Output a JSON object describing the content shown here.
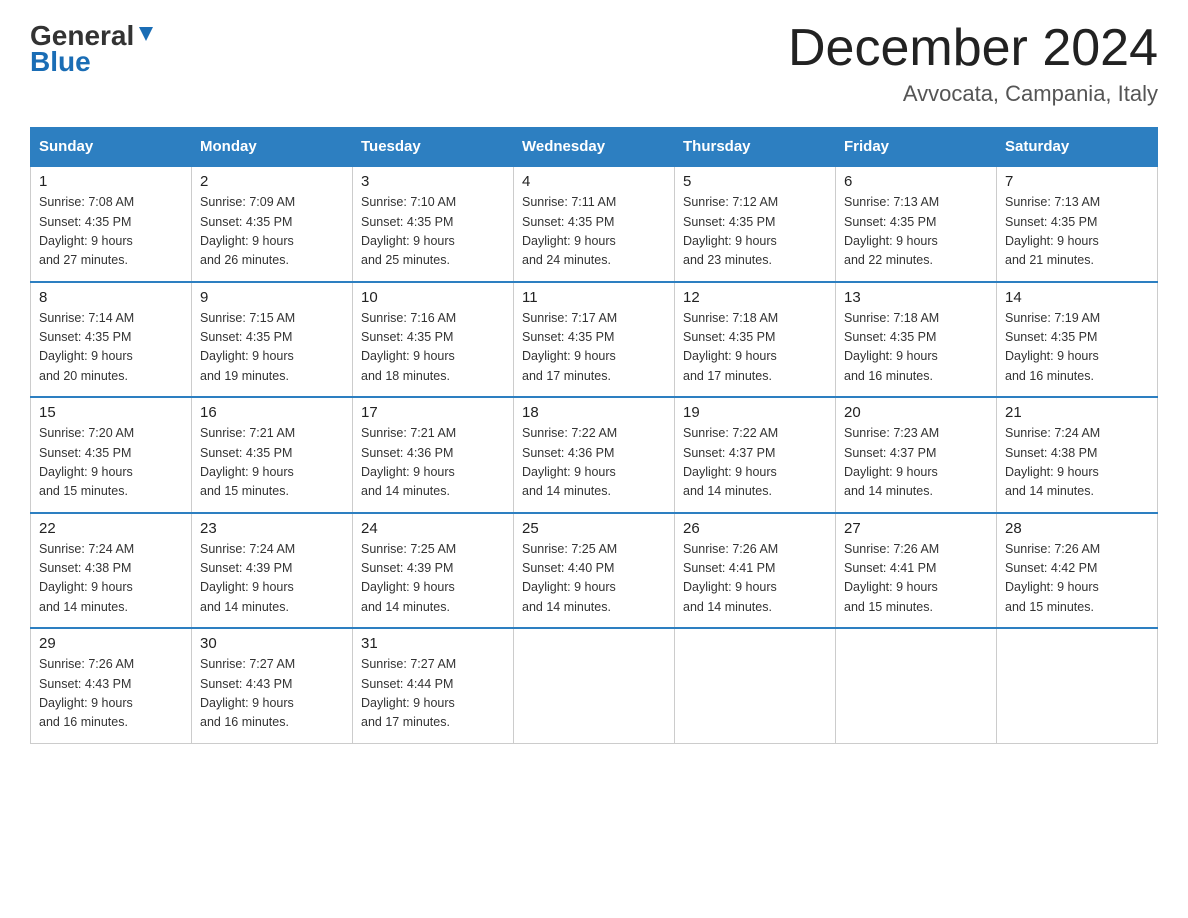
{
  "header": {
    "logo_general": "General",
    "logo_blue": "Blue",
    "title": "December 2024",
    "subtitle": "Avvocata, Campania, Italy"
  },
  "calendar": {
    "headers": [
      "Sunday",
      "Monday",
      "Tuesday",
      "Wednesday",
      "Thursday",
      "Friday",
      "Saturday"
    ],
    "weeks": [
      [
        {
          "day": "1",
          "sunrise": "Sunrise: 7:08 AM",
          "sunset": "Sunset: 4:35 PM",
          "daylight": "Daylight: 9 hours and 27 minutes."
        },
        {
          "day": "2",
          "sunrise": "Sunrise: 7:09 AM",
          "sunset": "Sunset: 4:35 PM",
          "daylight": "Daylight: 9 hours and 26 minutes."
        },
        {
          "day": "3",
          "sunrise": "Sunrise: 7:10 AM",
          "sunset": "Sunset: 4:35 PM",
          "daylight": "Daylight: 9 hours and 25 minutes."
        },
        {
          "day": "4",
          "sunrise": "Sunrise: 7:11 AM",
          "sunset": "Sunset: 4:35 PM",
          "daylight": "Daylight: 9 hours and 24 minutes."
        },
        {
          "day": "5",
          "sunrise": "Sunrise: 7:12 AM",
          "sunset": "Sunset: 4:35 PM",
          "daylight": "Daylight: 9 hours and 23 minutes."
        },
        {
          "day": "6",
          "sunrise": "Sunrise: 7:13 AM",
          "sunset": "Sunset: 4:35 PM",
          "daylight": "Daylight: 9 hours and 22 minutes."
        },
        {
          "day": "7",
          "sunrise": "Sunrise: 7:13 AM",
          "sunset": "Sunset: 4:35 PM",
          "daylight": "Daylight: 9 hours and 21 minutes."
        }
      ],
      [
        {
          "day": "8",
          "sunrise": "Sunrise: 7:14 AM",
          "sunset": "Sunset: 4:35 PM",
          "daylight": "Daylight: 9 hours and 20 minutes."
        },
        {
          "day": "9",
          "sunrise": "Sunrise: 7:15 AM",
          "sunset": "Sunset: 4:35 PM",
          "daylight": "Daylight: 9 hours and 19 minutes."
        },
        {
          "day": "10",
          "sunrise": "Sunrise: 7:16 AM",
          "sunset": "Sunset: 4:35 PM",
          "daylight": "Daylight: 9 hours and 18 minutes."
        },
        {
          "day": "11",
          "sunrise": "Sunrise: 7:17 AM",
          "sunset": "Sunset: 4:35 PM",
          "daylight": "Daylight: 9 hours and 17 minutes."
        },
        {
          "day": "12",
          "sunrise": "Sunrise: 7:18 AM",
          "sunset": "Sunset: 4:35 PM",
          "daylight": "Daylight: 9 hours and 17 minutes."
        },
        {
          "day": "13",
          "sunrise": "Sunrise: 7:18 AM",
          "sunset": "Sunset: 4:35 PM",
          "daylight": "Daylight: 9 hours and 16 minutes."
        },
        {
          "day": "14",
          "sunrise": "Sunrise: 7:19 AM",
          "sunset": "Sunset: 4:35 PM",
          "daylight": "Daylight: 9 hours and 16 minutes."
        }
      ],
      [
        {
          "day": "15",
          "sunrise": "Sunrise: 7:20 AM",
          "sunset": "Sunset: 4:35 PM",
          "daylight": "Daylight: 9 hours and 15 minutes."
        },
        {
          "day": "16",
          "sunrise": "Sunrise: 7:21 AM",
          "sunset": "Sunset: 4:35 PM",
          "daylight": "Daylight: 9 hours and 15 minutes."
        },
        {
          "day": "17",
          "sunrise": "Sunrise: 7:21 AM",
          "sunset": "Sunset: 4:36 PM",
          "daylight": "Daylight: 9 hours and 14 minutes."
        },
        {
          "day": "18",
          "sunrise": "Sunrise: 7:22 AM",
          "sunset": "Sunset: 4:36 PM",
          "daylight": "Daylight: 9 hours and 14 minutes."
        },
        {
          "day": "19",
          "sunrise": "Sunrise: 7:22 AM",
          "sunset": "Sunset: 4:37 PM",
          "daylight": "Daylight: 9 hours and 14 minutes."
        },
        {
          "day": "20",
          "sunrise": "Sunrise: 7:23 AM",
          "sunset": "Sunset: 4:37 PM",
          "daylight": "Daylight: 9 hours and 14 minutes."
        },
        {
          "day": "21",
          "sunrise": "Sunrise: 7:24 AM",
          "sunset": "Sunset: 4:38 PM",
          "daylight": "Daylight: 9 hours and 14 minutes."
        }
      ],
      [
        {
          "day": "22",
          "sunrise": "Sunrise: 7:24 AM",
          "sunset": "Sunset: 4:38 PM",
          "daylight": "Daylight: 9 hours and 14 minutes."
        },
        {
          "day": "23",
          "sunrise": "Sunrise: 7:24 AM",
          "sunset": "Sunset: 4:39 PM",
          "daylight": "Daylight: 9 hours and 14 minutes."
        },
        {
          "day": "24",
          "sunrise": "Sunrise: 7:25 AM",
          "sunset": "Sunset: 4:39 PM",
          "daylight": "Daylight: 9 hours and 14 minutes."
        },
        {
          "day": "25",
          "sunrise": "Sunrise: 7:25 AM",
          "sunset": "Sunset: 4:40 PM",
          "daylight": "Daylight: 9 hours and 14 minutes."
        },
        {
          "day": "26",
          "sunrise": "Sunrise: 7:26 AM",
          "sunset": "Sunset: 4:41 PM",
          "daylight": "Daylight: 9 hours and 14 minutes."
        },
        {
          "day": "27",
          "sunrise": "Sunrise: 7:26 AM",
          "sunset": "Sunset: 4:41 PM",
          "daylight": "Daylight: 9 hours and 15 minutes."
        },
        {
          "day": "28",
          "sunrise": "Sunrise: 7:26 AM",
          "sunset": "Sunset: 4:42 PM",
          "daylight": "Daylight: 9 hours and 15 minutes."
        }
      ],
      [
        {
          "day": "29",
          "sunrise": "Sunrise: 7:26 AM",
          "sunset": "Sunset: 4:43 PM",
          "daylight": "Daylight: 9 hours and 16 minutes."
        },
        {
          "day": "30",
          "sunrise": "Sunrise: 7:27 AM",
          "sunset": "Sunset: 4:43 PM",
          "daylight": "Daylight: 9 hours and 16 minutes."
        },
        {
          "day": "31",
          "sunrise": "Sunrise: 7:27 AM",
          "sunset": "Sunset: 4:44 PM",
          "daylight": "Daylight: 9 hours and 17 minutes."
        },
        null,
        null,
        null,
        null
      ]
    ]
  }
}
